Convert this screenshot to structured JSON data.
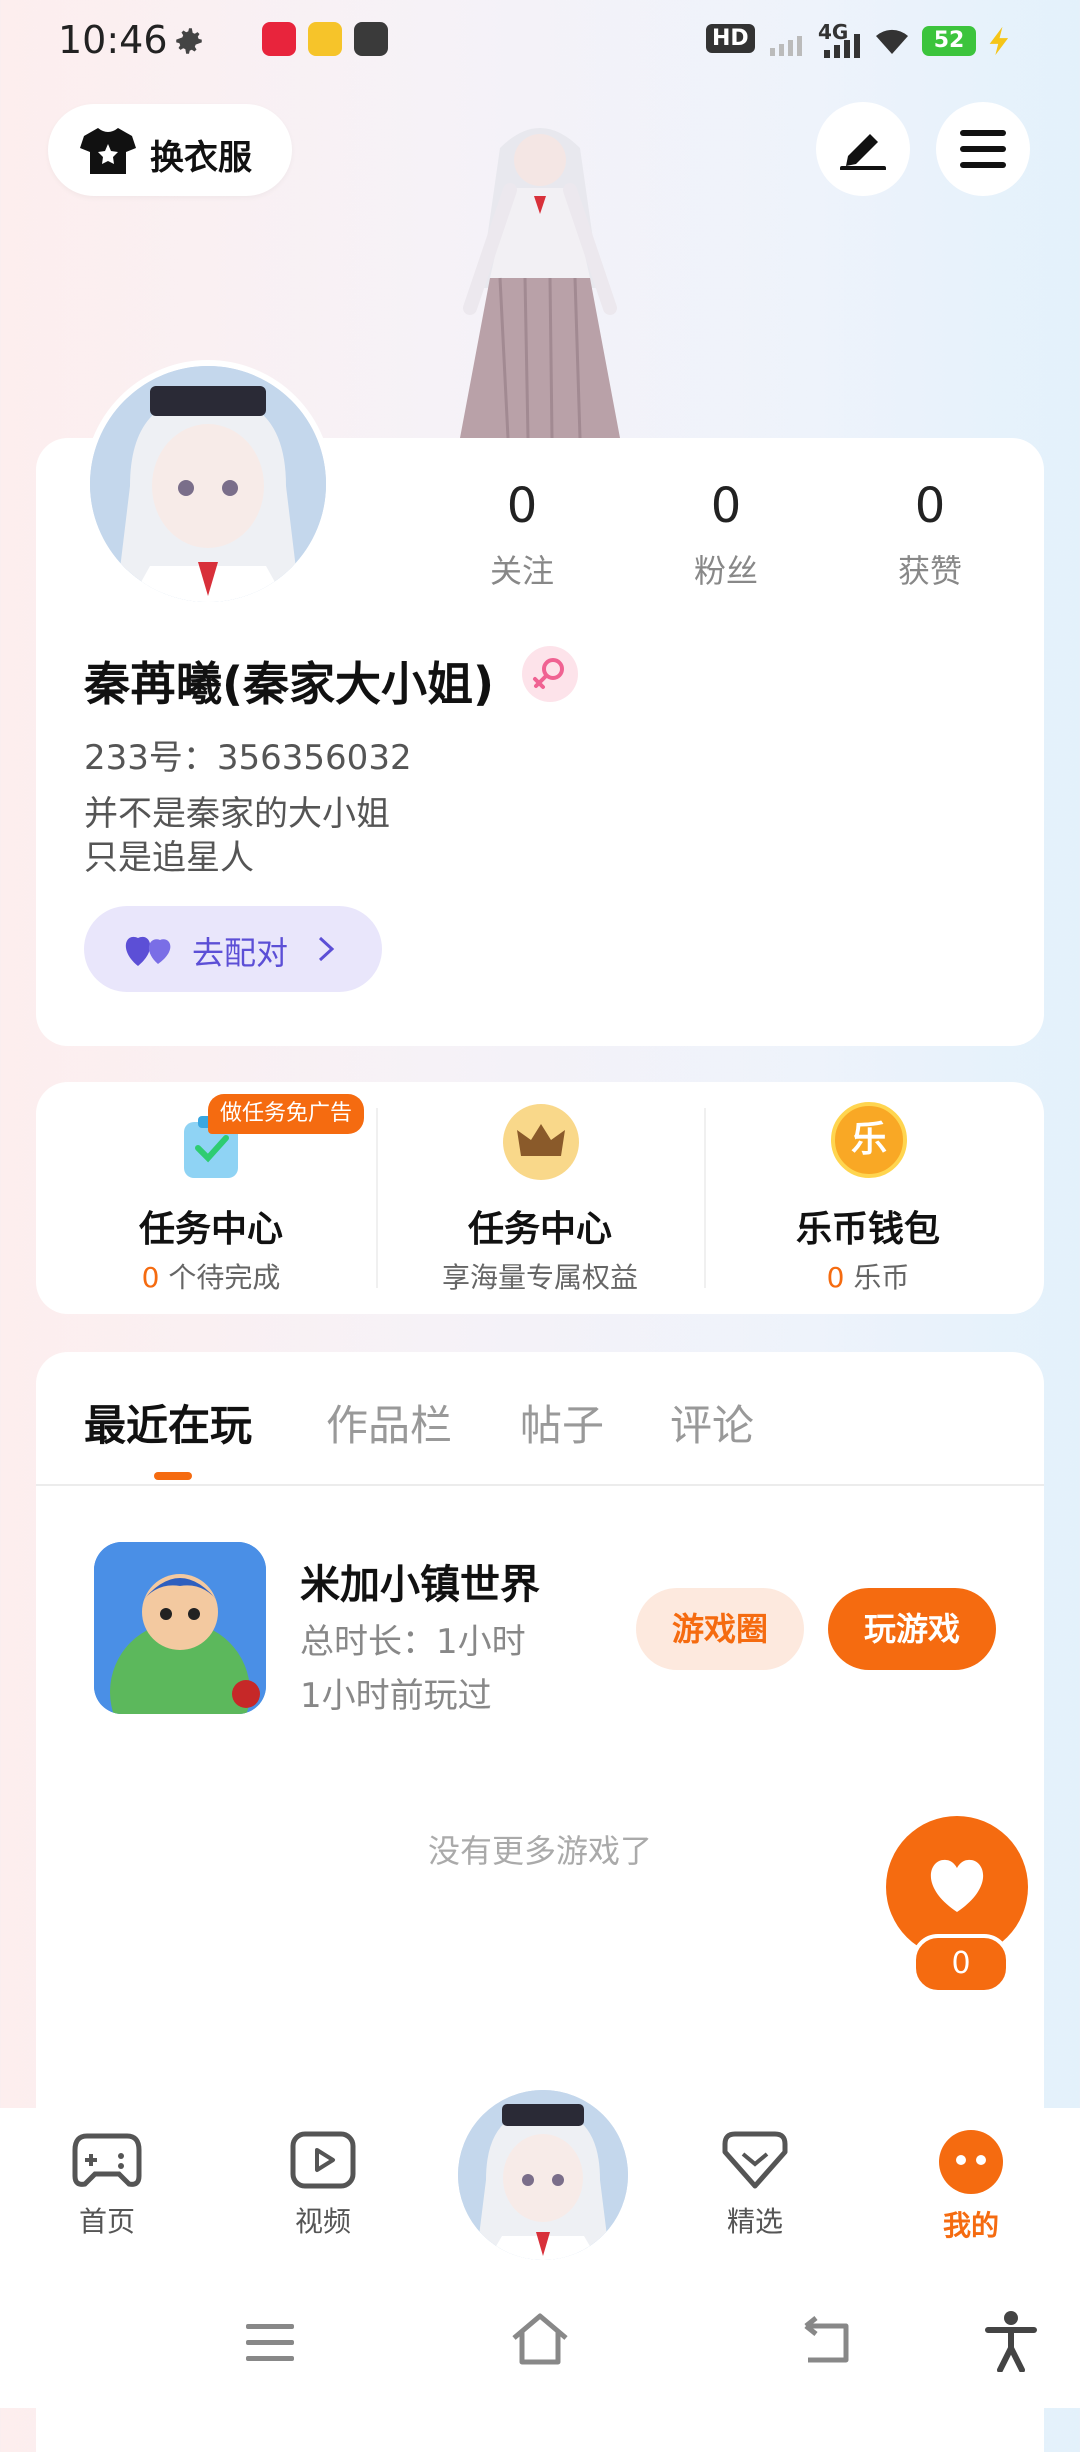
{
  "status_bar": {
    "time": "10:46",
    "network": "4G",
    "hd": "HD",
    "battery": "52"
  },
  "top_bar": {
    "outfit_label": "换衣服"
  },
  "profile": {
    "stats": [
      {
        "num": "0",
        "label": "关注"
      },
      {
        "num": "0",
        "label": "粉丝"
      },
      {
        "num": "0",
        "label": "获赞"
      }
    ],
    "name": "秦苒曦(秦家大小姐)",
    "uid": "233号：356356032",
    "bio_line1": "并不是秦家的大小姐",
    "bio_line2": "只是追星人",
    "pair_label": "去配对"
  },
  "tasks": {
    "ad_badge": "做任务免广告",
    "items": [
      {
        "title": "任务中心",
        "num": "0",
        "sub": " 个待完成"
      },
      {
        "title": "任务中心",
        "sub": "享海量专属权益"
      },
      {
        "title": "乐币钱包",
        "num": "0",
        "sub": " 乐币"
      }
    ],
    "coin_char": "乐"
  },
  "tabs": [
    "最近在玩",
    "作品栏",
    "帖子",
    "评论"
  ],
  "recent_game": {
    "name": "米加小镇世界",
    "duration": "总时长：1小时",
    "last_played": "1小时前玩过",
    "circle_btn": "游戏圈",
    "play_btn": "玩游戏"
  },
  "no_more": "没有更多游戏了",
  "fab_count": "0",
  "bottom_nav": [
    {
      "label": "首页"
    },
    {
      "label": "视频"
    },
    {
      "label": "精选"
    },
    {
      "label": "我的"
    }
  ],
  "colors": {
    "accent": "#f56b10",
    "pair": "#5c4fd6"
  }
}
